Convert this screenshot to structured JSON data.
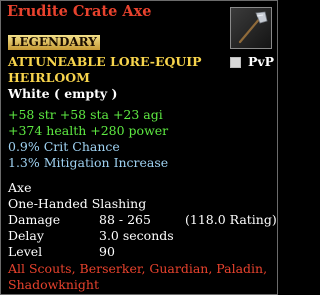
{
  "item": {
    "name": "Erudite Crate Axe",
    "rarity": "LEGENDARY",
    "flags_line1": "ATTUNEABLE   LORE-EQUIP",
    "flags_line2": "HEIRLOOM",
    "adornment": "White ( empty )",
    "pvp_label": "PvP",
    "icon": "axe-icon"
  },
  "stats": {
    "line1": "+58 str   +58 sta   +23 agi",
    "line2": "+374 health   +280 power",
    "crit": "0.9% Crit Chance",
    "mitigation": "1.3% Mitigation Increase"
  },
  "weapon": {
    "type": "Axe",
    "slot": "One-Handed Slashing",
    "damage_label": "Damage",
    "damage_value": "88 - 265",
    "damage_rating": "(118.0 Rating)",
    "delay_label": "Delay",
    "delay_value": "3.0 seconds",
    "level_label": "Level",
    "level_value": "90"
  },
  "classes": {
    "line1": "All Scouts, Berserker, Guardian, Paladin,",
    "line2": "Shadowknight"
  },
  "colors": {
    "title": "#e8422d",
    "legendary_bg": "#d9b85a",
    "flags": "#f7d44c",
    "stats": "#5eea42",
    "effects": "#9fd2f2",
    "classes": "#e8422d"
  }
}
